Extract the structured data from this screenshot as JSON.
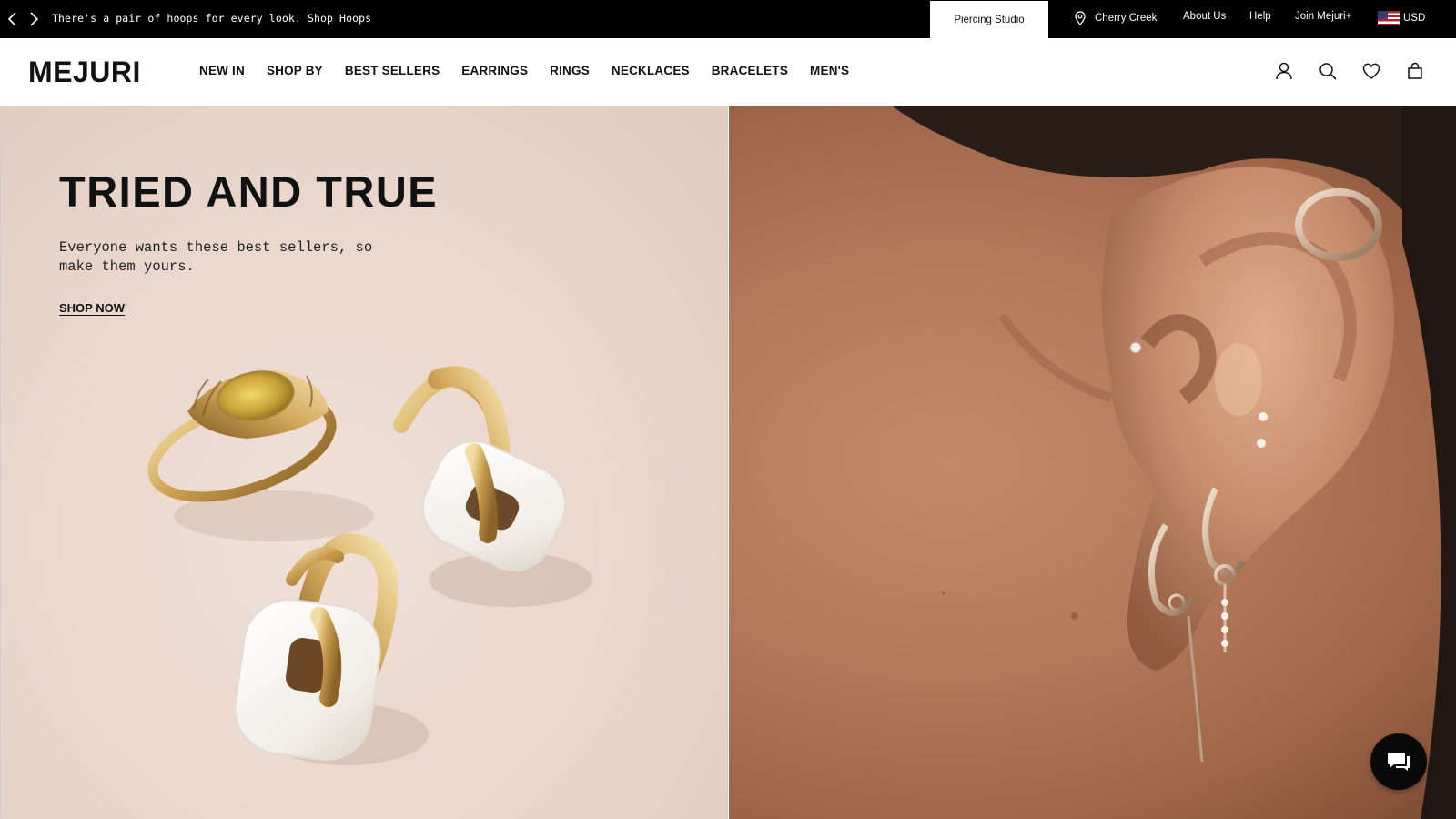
{
  "announcement": {
    "prev_icon": "chevron-left-icon",
    "next_icon": "chevron-right-icon",
    "message": "There's a pair of hoops for every look. Shop Hoops"
  },
  "utility_nav": {
    "piercing_studio": "Piercing Studio",
    "location_icon": "map-pin-icon",
    "location": "Cherry Creek",
    "about": "About Us",
    "help": "Help",
    "join": "Join Mejuri+",
    "currency_flag": "us-flag-icon",
    "currency": "USD"
  },
  "header": {
    "logo": "MEJURI",
    "nav": [
      "NEW IN",
      "SHOP BY",
      "BEST SELLERS",
      "EARRINGS",
      "RINGS",
      "NECKLACES",
      "BRACELETS",
      "MEN'S"
    ],
    "icons": [
      "account-icon",
      "search-icon",
      "wishlist-heart-icon",
      "shopping-bag-icon"
    ]
  },
  "hero": {
    "title": "TRIED AND TRUE",
    "subtitle": "Everyone wants these best sellers, so make them yours.",
    "cta": "SHOP NOW",
    "left_image": "ring-and-enamel-hoop-earrings-image",
    "right_image": "ear-with-stacked-earrings-image"
  },
  "chat": {
    "icon": "chat-bubble-icon"
  },
  "colors": {
    "topbar_bg": "#000000",
    "hero_left_bg": "#ead6cc",
    "gold": "#c9a25a",
    "enamel": "#f2efe9"
  }
}
